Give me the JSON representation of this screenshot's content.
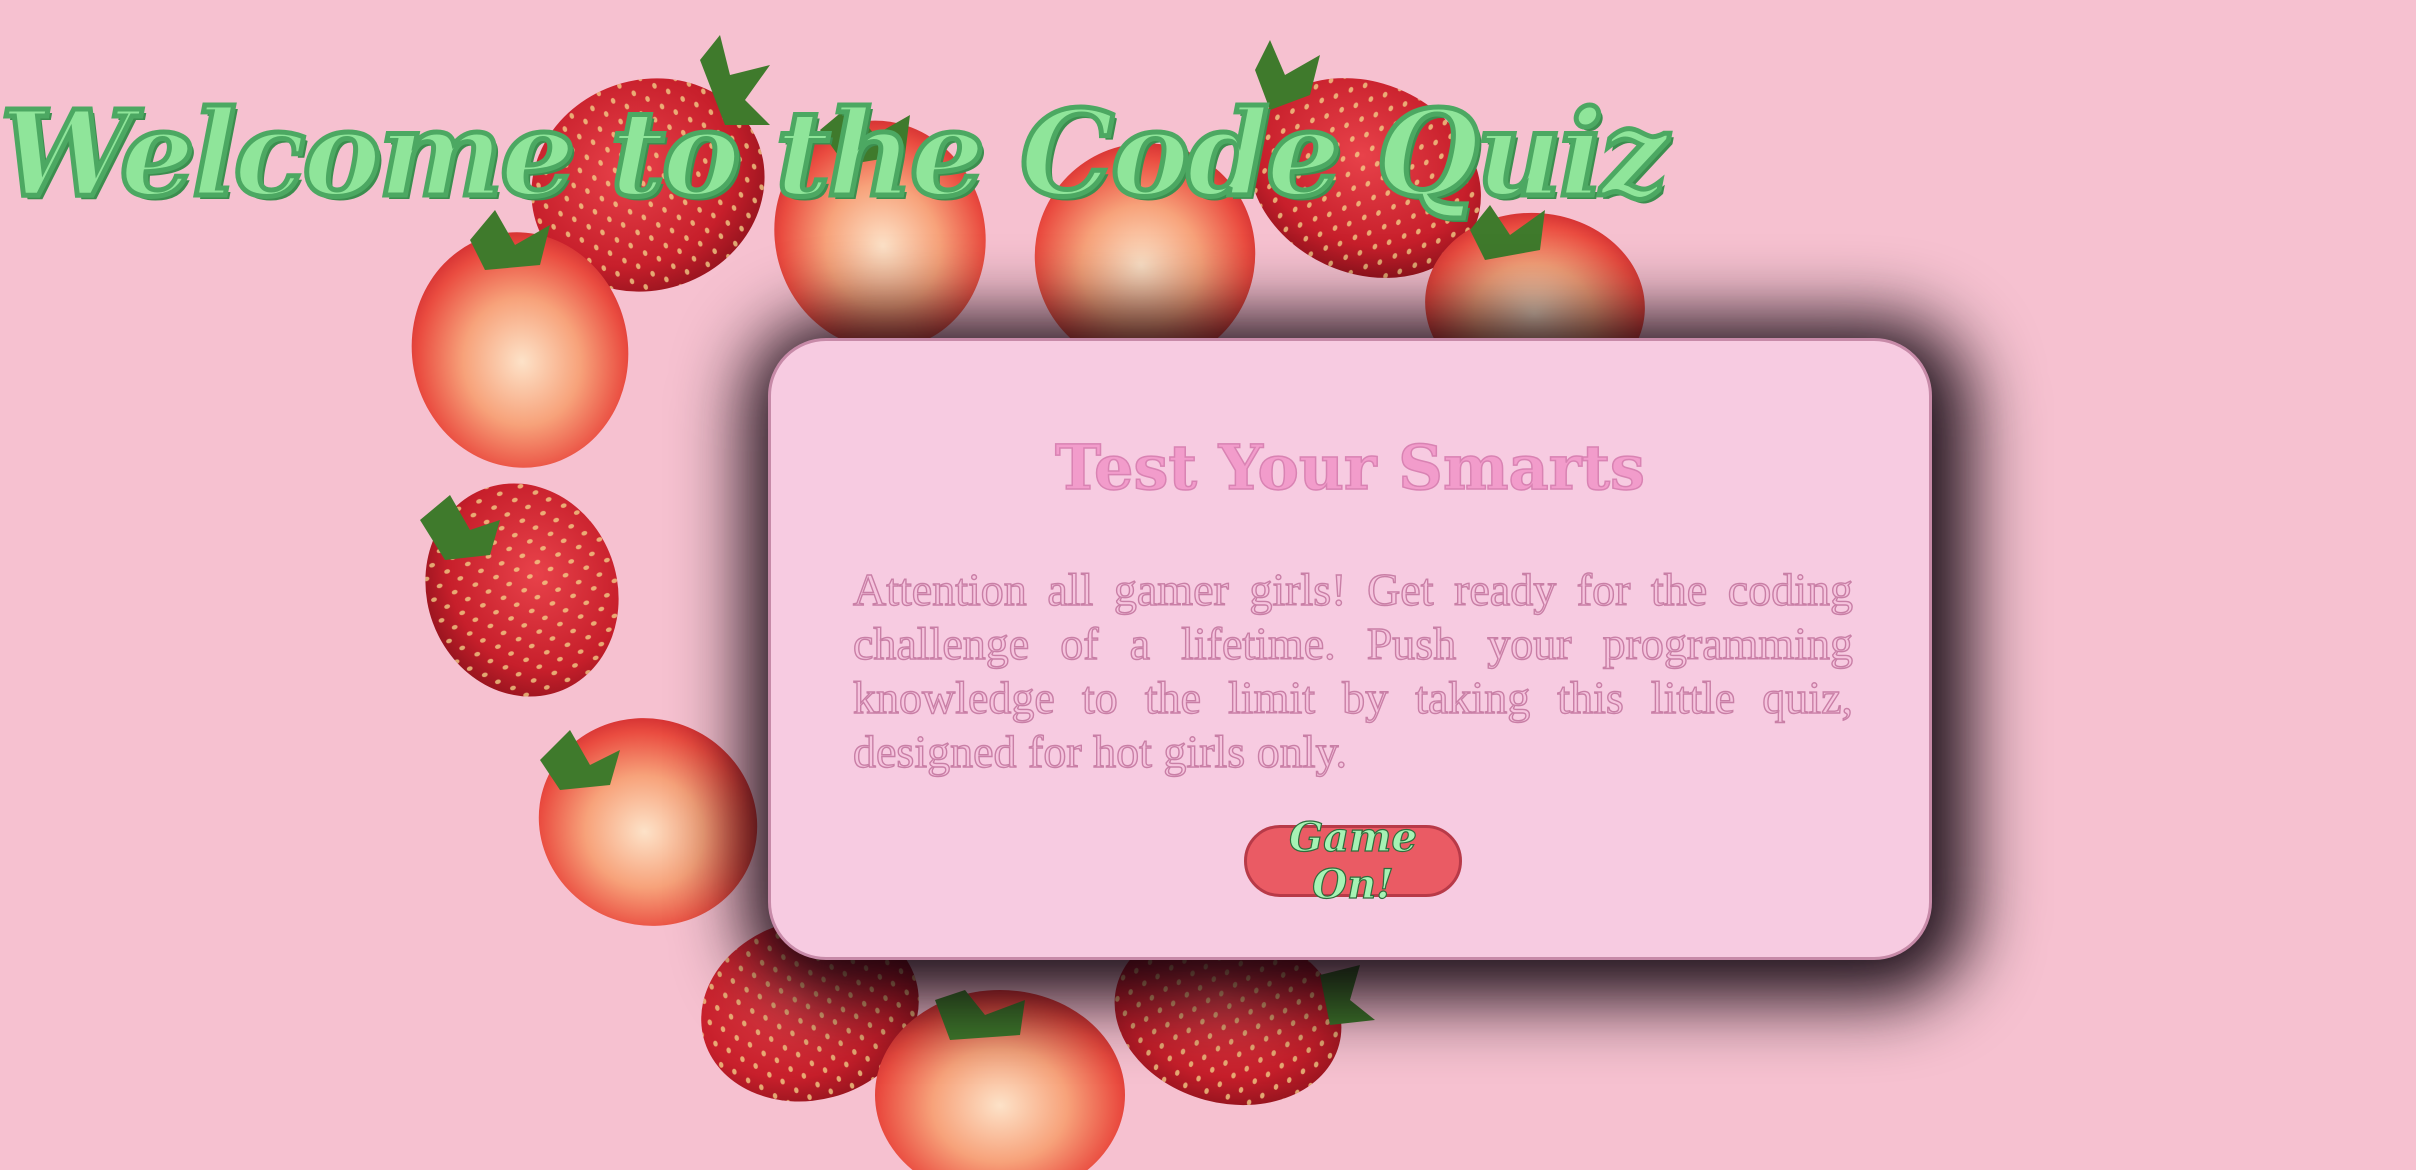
{
  "page": {
    "title": "Welcome to the Code Quiz"
  },
  "card": {
    "heading": "Test Your Smarts",
    "body": "Attention all gamer girls! Get ready for the coding challenge of a lifetime. Push your programming knowledge to the limit by taking this little quiz, designed for hot girls only.",
    "start_button_label": "Game On!"
  },
  "colors": {
    "background": "#f6c1d0",
    "title_fill": "#8fe59a",
    "card_background": "#f7cbe1",
    "heading_color": "#f29ccb",
    "button_background": "#ea5b64",
    "button_text": "#a6f3b4",
    "strawberry_red": "#d42a32"
  },
  "background_image": {
    "icon": "strawberry-heart-image"
  }
}
